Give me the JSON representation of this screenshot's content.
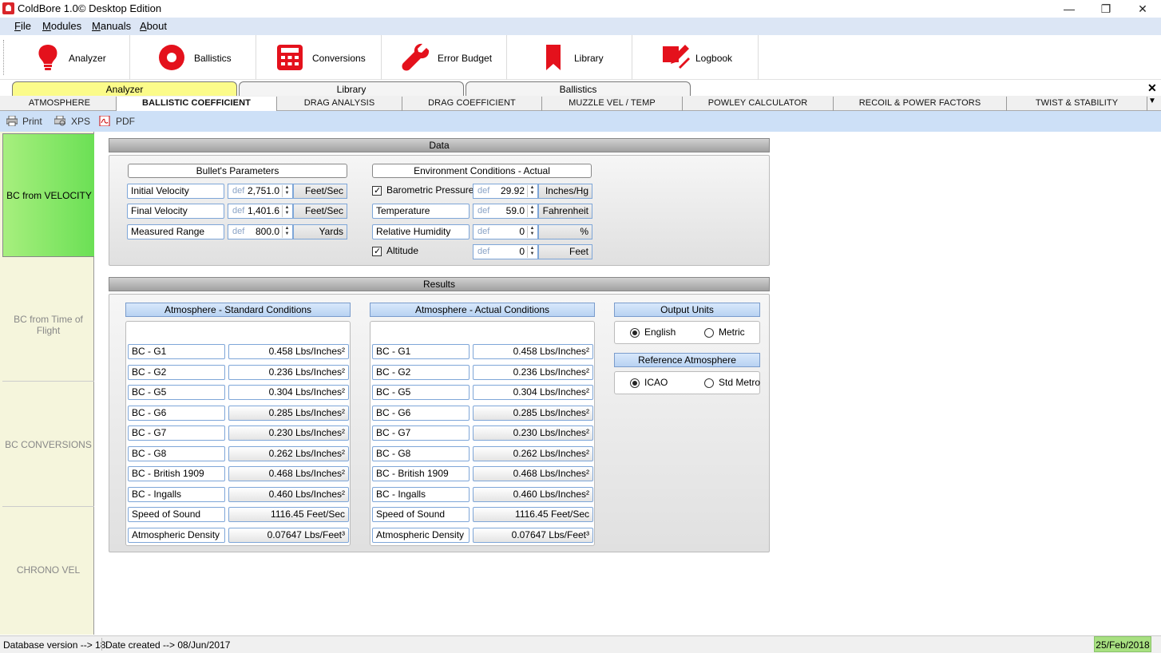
{
  "window": {
    "title": "ColdBore 1.0© Desktop Edition",
    "min": "—",
    "restore": "❐",
    "close": "✕"
  },
  "menu": {
    "file": {
      "first": "F",
      "rest": "ile"
    },
    "modules": {
      "first": "M",
      "rest": "odules"
    },
    "manuals": {
      "first": "M",
      "rest": "anuals"
    },
    "about": {
      "first": "A",
      "rest": "bout"
    }
  },
  "toolbar": [
    {
      "label": "Analyzer",
      "icon": "bulb-icon"
    },
    {
      "label": "Ballistics",
      "icon": "target-icon"
    },
    {
      "label": "Conversions",
      "icon": "calculator-icon"
    },
    {
      "label": "Error Budget",
      "icon": "wrench-icon"
    },
    {
      "label": "Library",
      "icon": "bookmark-icon"
    },
    {
      "label": "Logbook",
      "icon": "pencil-icon"
    }
  ],
  "module_tabs": [
    "Analyzer",
    "Library",
    "Ballistics"
  ],
  "sub_tabs": [
    "ATMOSPHERE",
    "BALLISTIC COEFFICIENT",
    "DRAG ANALYSIS",
    "DRAG COEFFICIENT",
    "MUZZLE VEL / TEMP",
    "POWLEY CALCULATOR",
    "RECOIL & POWER FACTORS",
    "TWIST & STABILITY"
  ],
  "print_bar": {
    "print": "Print",
    "xps": "XPS",
    "pdf": "PDF"
  },
  "left_tabs": [
    "BC from VELOCITY",
    "BC from Time of Flight",
    "BC CONVERSIONS",
    "CHRONO VEL"
  ],
  "data_section": {
    "title": "Data",
    "bullet": {
      "title": "Bullet's Parameters",
      "rows": [
        {
          "label": "Initial Velocity",
          "def": "def",
          "value": "2,751.0",
          "unit": "Feet/Sec"
        },
        {
          "label": "Final Velocity",
          "def": "def",
          "value": "1,401.6",
          "unit": "Feet/Sec"
        },
        {
          "label": "Measured Range",
          "def": "def",
          "value": "800.0",
          "unit": "Yards"
        }
      ]
    },
    "environment": {
      "title": "Environment Conditions - Actual",
      "rows": [
        {
          "label": "Barometric Pressure",
          "def": "def",
          "value": "29.92",
          "unit": "Inches/Hg",
          "checkbox": true
        },
        {
          "label": "Temperature",
          "def": "def",
          "value": "59.0",
          "unit": "Fahrenheit"
        },
        {
          "label": "Relative Humidity",
          "def": "def",
          "value": "0",
          "unit": "%"
        },
        {
          "label": "Altitude",
          "def": "def",
          "value": "0",
          "unit": "Feet",
          "checkbox": true
        }
      ]
    }
  },
  "results_section": {
    "title": "Results",
    "standard": {
      "title": "Atmosphere - Standard Conditions",
      "rows": [
        {
          "label": "BC - G1",
          "value": "0.458 Lbs/Inches²"
        },
        {
          "label": "BC - G2",
          "value": "0.236 Lbs/Inches²"
        },
        {
          "label": "BC - G5",
          "value": "0.304 Lbs/Inches²"
        },
        {
          "label": "BC - G6",
          "value": "0.285 Lbs/Inches²"
        },
        {
          "label": "BC - G7",
          "value": "0.230 Lbs/Inches²"
        },
        {
          "label": "BC - G8",
          "value": "0.262 Lbs/Inches²"
        },
        {
          "label": "BC - British 1909",
          "value": "0.468 Lbs/Inches²"
        },
        {
          "label": "BC - Ingalls",
          "value": "0.460 Lbs/Inches²"
        },
        {
          "label": "Speed of Sound",
          "value": "1116.45 Feet/Sec"
        },
        {
          "label": "Atmospheric Density",
          "value": "0.07647 Lbs/Feet³"
        }
      ]
    },
    "actual": {
      "title": "Atmosphere - Actual Conditions",
      "rows": [
        {
          "label": "BC - G1",
          "value": "0.458 Lbs/Inches²"
        },
        {
          "label": "BC - G2",
          "value": "0.236 Lbs/Inches²"
        },
        {
          "label": "BC - G5",
          "value": "0.304 Lbs/Inches²"
        },
        {
          "label": "BC - G6",
          "value": "0.285 Lbs/Inches²"
        },
        {
          "label": "BC - G7",
          "value": "0.230 Lbs/Inches²"
        },
        {
          "label": "BC - G8",
          "value": "0.262 Lbs/Inches²"
        },
        {
          "label": "BC - British 1909",
          "value": "0.468 Lbs/Inches²"
        },
        {
          "label": "BC - Ingalls",
          "value": "0.460 Lbs/Inches²"
        },
        {
          "label": "Speed of Sound",
          "value": "1116.45 Feet/Sec"
        },
        {
          "label": "Atmospheric Density",
          "value": "0.07647 Lbs/Feet³"
        }
      ]
    },
    "output_units": {
      "title": "Output Units",
      "english": "English",
      "metric": "Metric",
      "selected": "English"
    },
    "reference_atmosphere": {
      "title": "Reference Atmosphere",
      "icao": "ICAO",
      "std_metro": "Std Metro",
      "selected": "ICAO"
    }
  },
  "status": {
    "db_version": "Database version --> 18",
    "date_created": "Date created --> 08/Jun/2017",
    "today": "25/Feb/2018"
  },
  "colors": {
    "accent_red": "#e4111c",
    "menu_bg": "#dce6f5",
    "active_tab_yellow": "#fbfb8a",
    "active_vtab_green": "#6be055"
  }
}
